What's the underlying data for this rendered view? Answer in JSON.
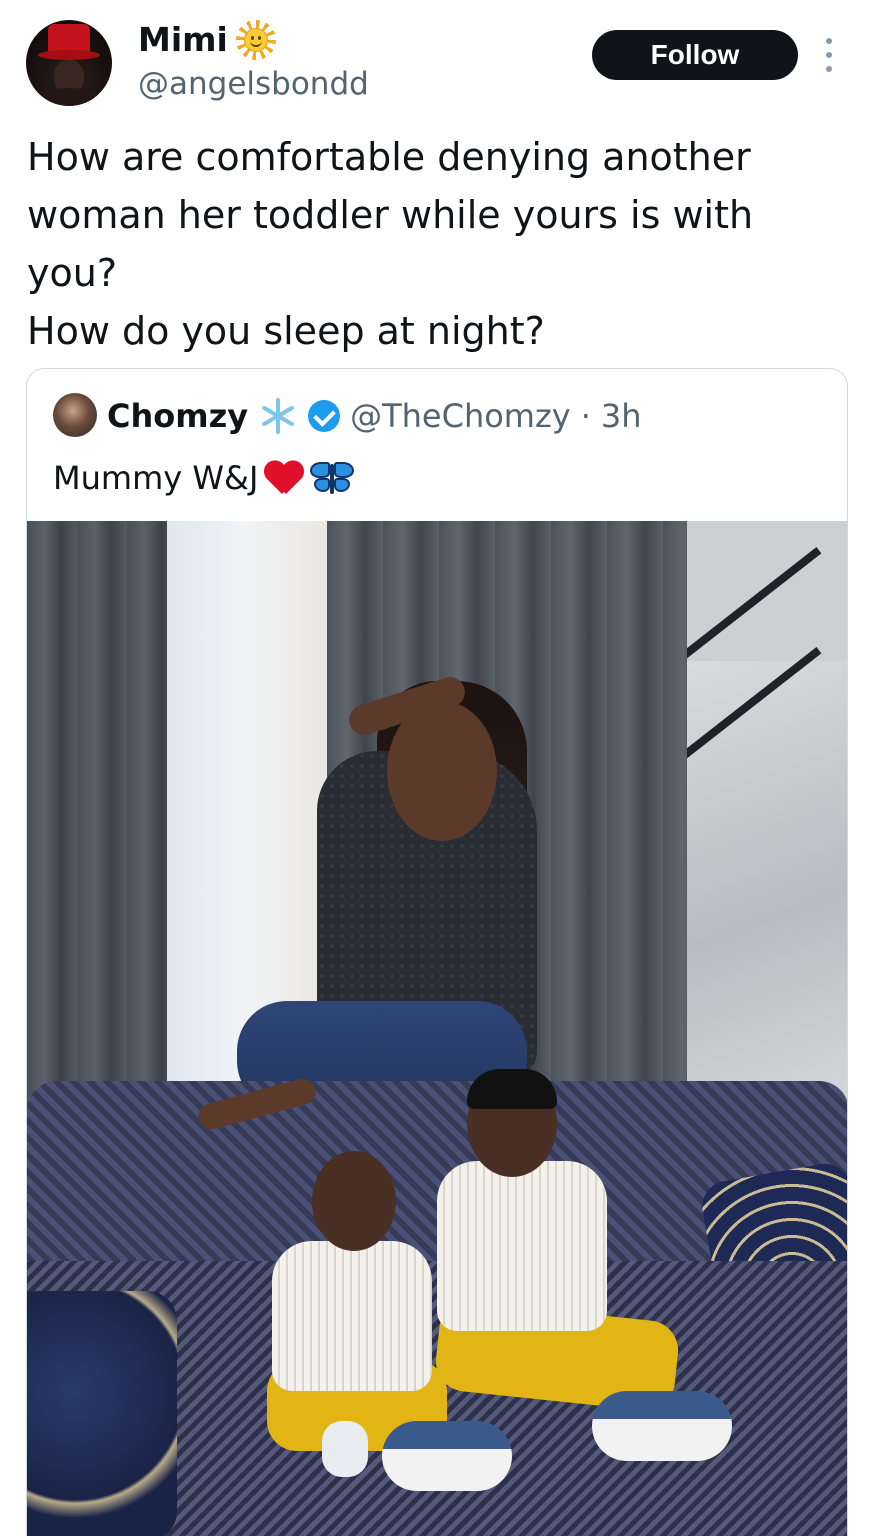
{
  "author": {
    "display_name": "Mimi",
    "handle": "@angelsbondd",
    "name_emoji": "sun-with-face-icon"
  },
  "header": {
    "follow_label": "Follow",
    "more_icon": "more-options-icon"
  },
  "tweet": {
    "lines": [
      "How are comfortable denying  another woman her toddler while yours is with you?",
      "How do you sleep at night?"
    ]
  },
  "quoted": {
    "display_name": "Chomzy",
    "handle": "@TheChomzy",
    "separator": "·",
    "time": "3h",
    "text": "Mummy W&J",
    "emojis": [
      "heart-icon",
      "butterfly-icon"
    ],
    "verified_color": "#1d9bf0"
  },
  "colors": {
    "follow_bg": "#0f1419",
    "text": "#0f1419",
    "muted": "#536471",
    "border": "#cfd9de"
  }
}
